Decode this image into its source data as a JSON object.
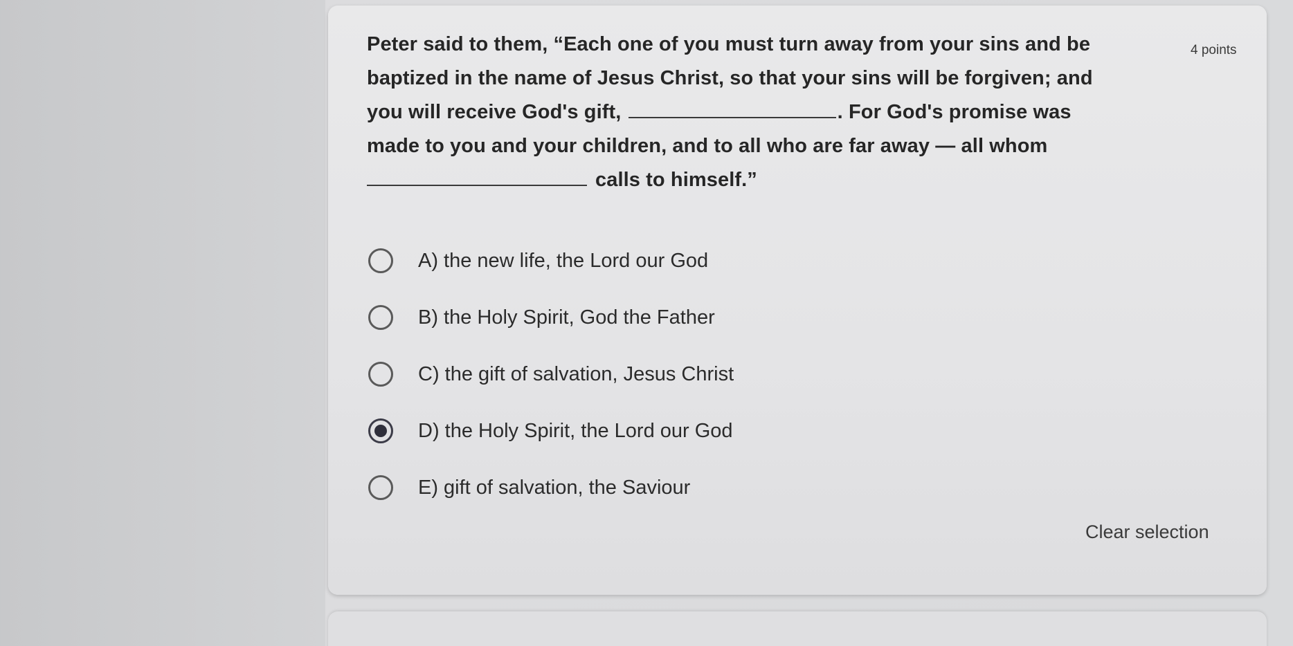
{
  "question": {
    "line1": "Peter said to them, “Each one of you must turn away from your sins and be",
    "line2": "baptized in the name of Jesus Christ, so that your sins will be forgiven; and",
    "line3_before": "you will receive God's gift,",
    "line3_after": ". For God's promise was",
    "line4": "made to you and your children, and to all who are far away — all whom",
    "line5_after": "calls to himself.”",
    "points": "4 points"
  },
  "options": [
    {
      "label": "A) the new life, the Lord our God",
      "selected": false
    },
    {
      "label": "B) the Holy Spirit, God the Father",
      "selected": false
    },
    {
      "label": "C) the gift of salvation, Jesus Christ",
      "selected": false
    },
    {
      "label": "D) the Holy Spirit, the Lord our God",
      "selected": true
    },
    {
      "label": "E) gift of salvation, the Saviour",
      "selected": false
    }
  ],
  "clear_selection": "Clear selection"
}
